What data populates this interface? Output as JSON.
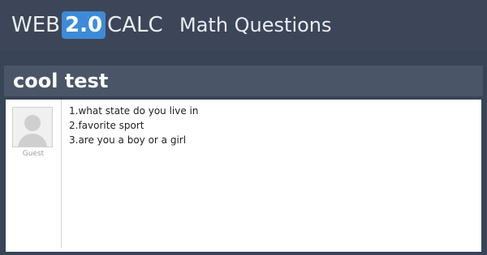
{
  "header": {
    "logo_prefix": "WEB",
    "logo_version": "2.0",
    "logo_suffix": "CALC",
    "site_title": "Math Questions"
  },
  "question": {
    "title": "cool test",
    "author": "Guest",
    "avatar_icon": "default-user-avatar-icon",
    "body_lines": [
      "1.what state do you live in",
      "2.favorite sport",
      "3.are you a boy or a girl"
    ]
  },
  "colors": {
    "background": "#394457",
    "title_bar": "#4a5668",
    "logo_accent": "#3d8bd8",
    "post_background": "#ffffff"
  }
}
